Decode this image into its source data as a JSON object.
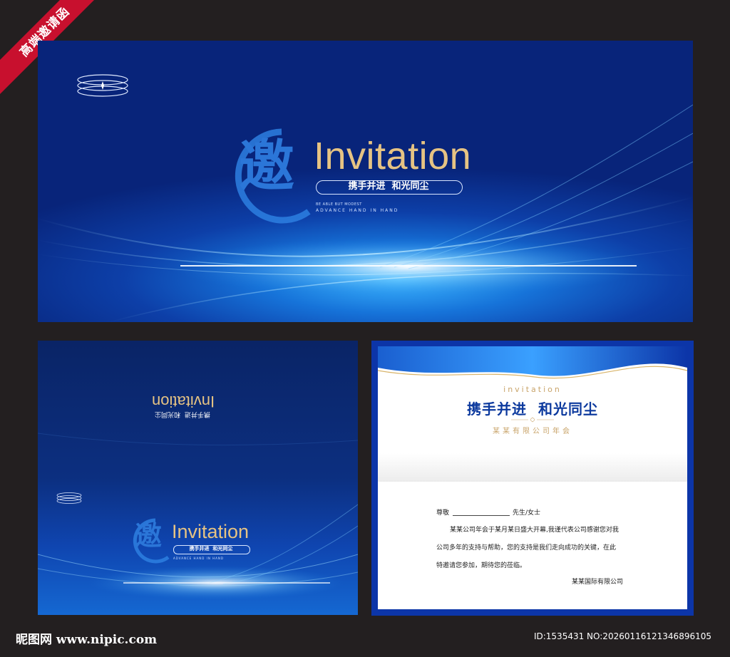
{
  "badge": {
    "label": "高端邀请函"
  },
  "cover": {
    "seal_char": "邀",
    "title": "Invitation",
    "slogan": "携手并进  和光同尘",
    "subtitle_line1": "BE ABLE BUT MODEST",
    "subtitle_line2": "ADVANCE HAND IN HAND"
  },
  "back_panel": {
    "mirrored_title": "Invitation",
    "mirrored_slogan": "携手并进  和光同尘",
    "seal_char": "邀",
    "title": "Invitation",
    "slogan": "携手并进  和光同尘",
    "subtitle": "ADVANCE HAND IN HAND"
  },
  "letter": {
    "header_en": "invitation",
    "title": "携手并进  和光同尘",
    "subtitle": "某某有限公司年会",
    "greeting_prefix": "尊敬",
    "greeting_suffix": "先生/女士",
    "body_line1": "某某公司年会于某月某日盛大开幕,我谨代表公司感谢您对我",
    "body_line2": "公司多年的支持与帮助，您的支持是我们走向成功的关键，在此",
    "body_line3": "特邀请您参加，期待您的莅临。",
    "signature": "某某国际有限公司"
  },
  "footer": {
    "site": "昵图网 www.nipic.com",
    "id_text": "ID:1535431 NO:20260116121346896105"
  },
  "colors": {
    "background": "#231f20",
    "navy": "#08247a",
    "blue": "#1673d9",
    "gold": "#e6c383",
    "title_blue": "#0d3a9e",
    "badge_red": "#c8102e"
  }
}
